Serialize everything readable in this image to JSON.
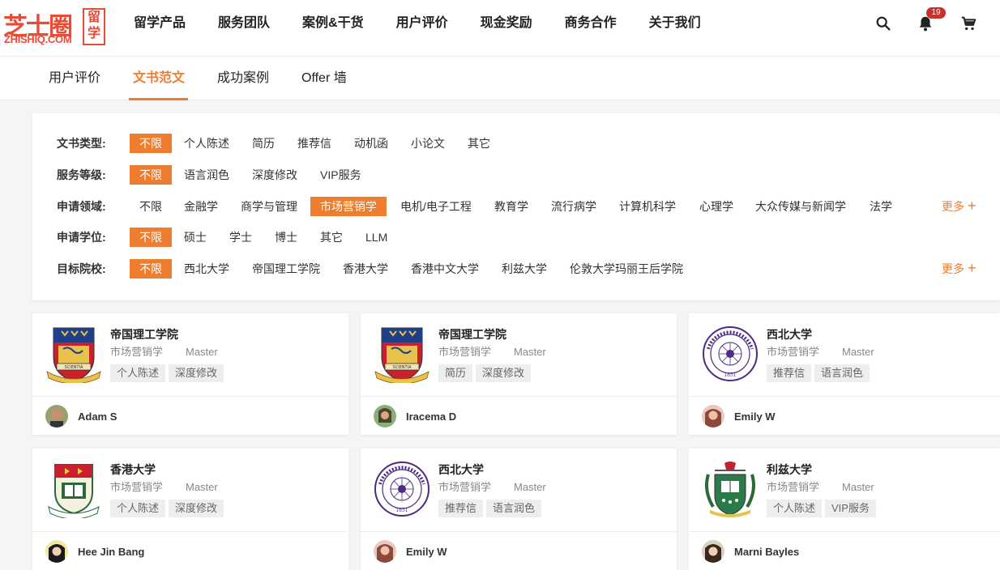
{
  "logo": {
    "cn": "芝士圈",
    "en": "ZHISHIQ.COM",
    "box": "留学"
  },
  "mainnav": [
    "留学产品",
    "服务团队",
    "案例&干货",
    "用户评价",
    "现金奖励",
    "商务合作",
    "关于我们"
  ],
  "notifications": {
    "count": "19"
  },
  "icons": {
    "search": "search-icon",
    "bell": "bell-icon",
    "cart": "cart-icon"
  },
  "colors": {
    "accent": "#ee7d30",
    "brand": "#ea4b35",
    "badge": "#c8302d"
  },
  "subnav": {
    "tabs": [
      "用户评价",
      "文书范文",
      "成功案例",
      "Offer 墙"
    ],
    "active": "文书范文"
  },
  "filters": {
    "more_label": "更多",
    "rows": [
      {
        "label": "文书类型:",
        "options": [
          "不限",
          "个人陈述",
          "简历",
          "推荐信",
          "动机函",
          "小论文",
          "其它"
        ],
        "selected": "不限"
      },
      {
        "label": "服务等级:",
        "options": [
          "不限",
          "语言润色",
          "深度修改",
          "VIP服务"
        ],
        "selected": "不限"
      },
      {
        "label": "申请领域:",
        "options": [
          "不限",
          "金融学",
          "商学与管理",
          "市场营销学",
          "电机/电子工程",
          "教育学",
          "流行病学",
          "计算机科学",
          "心理学",
          "大众传媒与新闻学",
          "法学"
        ],
        "selected": "市场营销学"
      },
      {
        "label": "申请学位:",
        "options": [
          "不限",
          "硕士",
          "学士",
          "博士",
          "其它",
          "LLM"
        ],
        "selected": "不限"
      },
      {
        "label": "目标院校:",
        "options": [
          "不限",
          "西北大学",
          "帝国理工学院",
          "香港大学",
          "香港中文大学",
          "利兹大学",
          "伦敦大学玛丽王后学院"
        ],
        "selected": "不限"
      }
    ]
  },
  "cards": [
    {
      "school": "帝国理工学院",
      "field": "市场营销学",
      "degree": "Master",
      "tags": [
        "个人陈述",
        "深度修改"
      ],
      "author": "Adam S",
      "crest": "imperial"
    },
    {
      "school": "帝国理工学院",
      "field": "市场营销学",
      "degree": "Master",
      "tags": [
        "简历",
        "深度修改"
      ],
      "author": "Iracema D",
      "crest": "imperial"
    },
    {
      "school": "西北大学",
      "field": "市场营销学",
      "degree": "Master",
      "tags": [
        "推荐信",
        "语言润色"
      ],
      "author": "Emily W",
      "crest": "northwestern"
    },
    {
      "school": "香港大学",
      "field": "市场营销学",
      "degree": "Master",
      "tags": [
        "个人陈述",
        "深度修改"
      ],
      "author": "Hee Jin Bang",
      "crest": "hku"
    },
    {
      "school": "西北大学",
      "field": "市场营销学",
      "degree": "Master",
      "tags": [
        "推荐信",
        "语言润色"
      ],
      "author": "Emily W",
      "crest": "northwestern"
    },
    {
      "school": "利兹大学",
      "field": "市场营销学",
      "degree": "Master",
      "tags": [
        "个人陈述",
        "VIP服务"
      ],
      "author": "Marni Bayles",
      "crest": "leeds"
    }
  ]
}
